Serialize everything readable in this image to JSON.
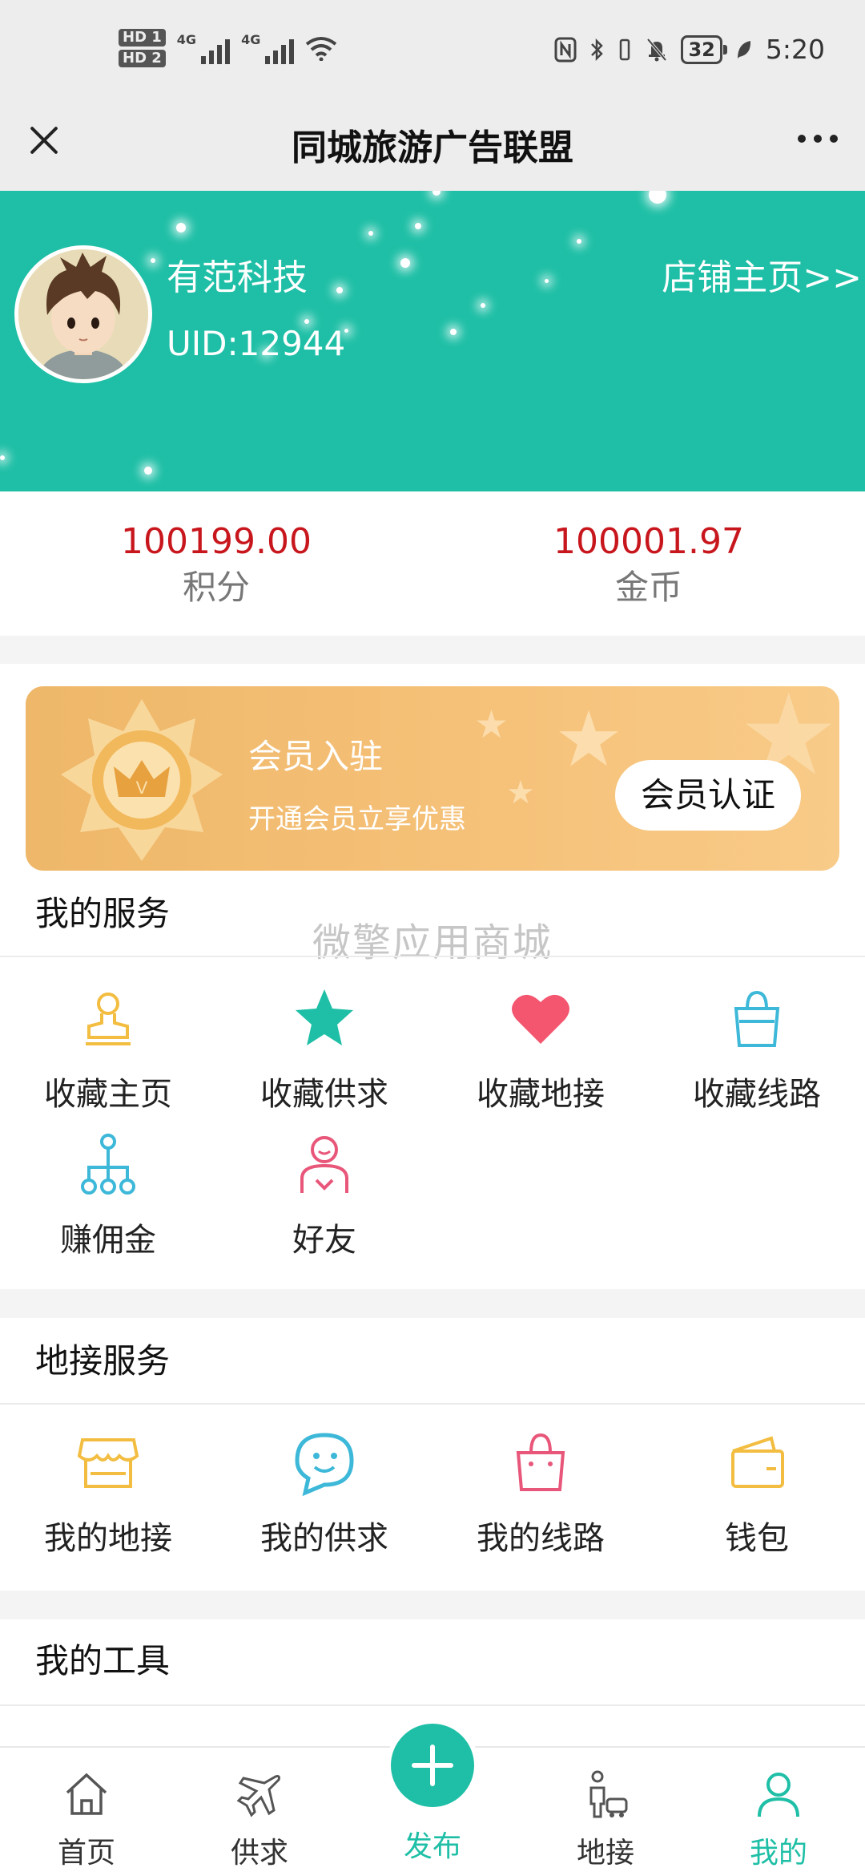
{
  "status_bar": {
    "hd1": "HD 1",
    "hd2": "HD 2",
    "net1": "4G",
    "net2": "4G",
    "battery": "32",
    "time": "5:20"
  },
  "title_bar": {
    "title": "同城旅游广告联盟"
  },
  "profile": {
    "username": "有范科技",
    "uid": "UID:12944",
    "shop_link": "店铺主页>>"
  },
  "stats": [
    {
      "value": "100199.00",
      "label": "积分"
    },
    {
      "value": "100001.97",
      "label": "金币"
    }
  ],
  "member_card": {
    "title": "会员入驻",
    "subtitle": "开通会员立享优惠",
    "button": "会员认证"
  },
  "watermark": "微擎应用商城",
  "my_services": {
    "title": "我的服务",
    "items": [
      {
        "label": "收藏主页",
        "icon": "stamp-icon"
      },
      {
        "label": "收藏供求",
        "icon": "star-icon"
      },
      {
        "label": "收藏地接",
        "icon": "heart-icon"
      },
      {
        "label": "收藏线路",
        "icon": "bag-icon"
      },
      {
        "label": "赚佣金",
        "icon": "network-icon"
      },
      {
        "label": "好友",
        "icon": "friend-icon"
      }
    ]
  },
  "local_services": {
    "title": "地接服务",
    "items": [
      {
        "label": "我的地接",
        "icon": "shop-icon"
      },
      {
        "label": "我的供求",
        "icon": "chat-icon"
      },
      {
        "label": "我的线路",
        "icon": "basket-icon"
      },
      {
        "label": "钱包",
        "icon": "wallet-icon"
      }
    ]
  },
  "my_tools": {
    "title": "我的工具"
  },
  "tab_bar": {
    "items": [
      {
        "label": "首页",
        "icon": "home-icon"
      },
      {
        "label": "供求",
        "icon": "plane-icon"
      },
      {
        "label": "发布",
        "icon": "plus-icon"
      },
      {
        "label": "地接",
        "icon": "guide-icon"
      },
      {
        "label": "我的",
        "icon": "user-icon"
      }
    ],
    "active": "我的"
  },
  "colors": {
    "primary": "#1ebfa6",
    "value_red": "#c8161d",
    "gold": "#f2bd72"
  }
}
